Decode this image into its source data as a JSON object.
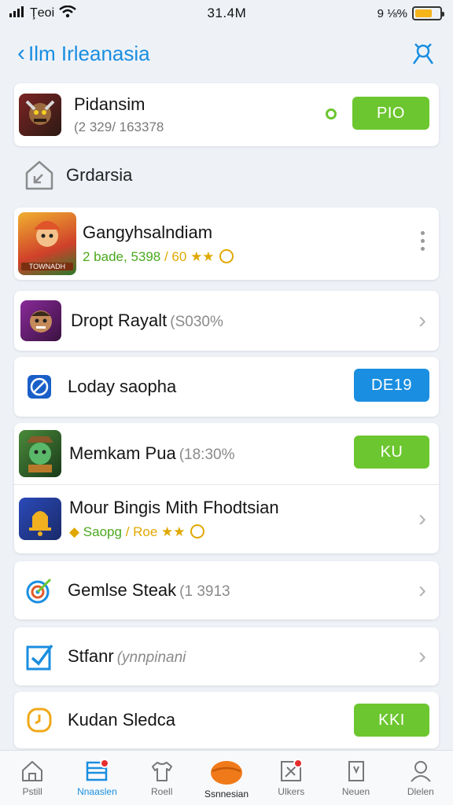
{
  "status_bar": {
    "carrier": "Ţeoi",
    "time": "31.4M",
    "right_text": "9 ⅛%"
  },
  "nav": {
    "back_label": "Ilm Irleanasia"
  },
  "top_card": {
    "title": "Pidansim",
    "subtitle": "(2 329/ 163378",
    "button": "PIO"
  },
  "section": {
    "title": "Grdarsia"
  },
  "featured": {
    "title": "Gangyhsalndiam",
    "meta_green": "2 bade, 5398",
    "meta_yellow": " / 60 ★★",
    "banner_text": "TOWNADH"
  },
  "items": [
    {
      "title": "Dropt Rayalt",
      "meta": "(S030%"
    },
    {
      "title": "Loday saopha",
      "button": "DE19"
    },
    {
      "title": "Memkam Pua",
      "meta": "(18:30%",
      "button": "KU"
    },
    {
      "title": "Mour Bingis Mith Fhodtsian",
      "meta_green": "Saopg",
      "meta_yellow": " / Roe ★★"
    },
    {
      "title": "Gemlse Steak",
      "meta": "(1 3913"
    },
    {
      "title": "Stfanr",
      "meta": "(ynnpinani"
    },
    {
      "title": "Kudan Sledca",
      "button": "KKI"
    }
  ],
  "tabs": [
    {
      "label": "Pstill"
    },
    {
      "label": "Nnaaslen"
    },
    {
      "label": "Roell"
    },
    {
      "label": "Ssnnesian"
    },
    {
      "label": "Ulkers"
    },
    {
      "label": "Neuen"
    },
    {
      "label": "Dlelen"
    }
  ],
  "colors": {
    "accent_blue": "#1a8ee0",
    "accent_green": "#6cc62f",
    "badge_red": "#e62e2e"
  }
}
